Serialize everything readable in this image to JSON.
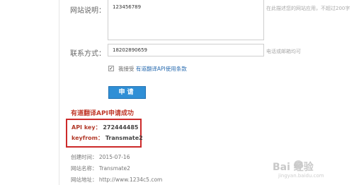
{
  "form": {
    "site_desc_label": "网站说明：",
    "site_desc_value": "123456789",
    "site_desc_hint": "在此描述您的网站应用，不超过200字",
    "contact_label": "联系方式：",
    "contact_value": "18202890659",
    "contact_hint": "电话或邮箱均可",
    "agree_checked": true,
    "agree_prefix": "我接受",
    "agree_link": "有道翻译API使用条款",
    "submit_label": "申请"
  },
  "result": {
    "success_title": "有道翻译API申请成功",
    "api_key_label": "API key：",
    "api_key_value": "272444485",
    "keyfrom_label": "keyfrom：",
    "keyfrom_value": "Transmate2",
    "created_label": "创建时间：",
    "created_value": "2015-07-16",
    "site_name_label": "网站名称：",
    "site_name_value": "Transmate2",
    "site_url_label": "网站地址：",
    "site_url_value": "http://www.1234c5.com"
  },
  "watermark": {
    "brand": "Bai  经验",
    "url": "jingyan.baidu.com"
  },
  "colors": {
    "accent": "#2f8fd6",
    "highlight_border": "#cc2a2a",
    "success_text": "#c0392b"
  }
}
